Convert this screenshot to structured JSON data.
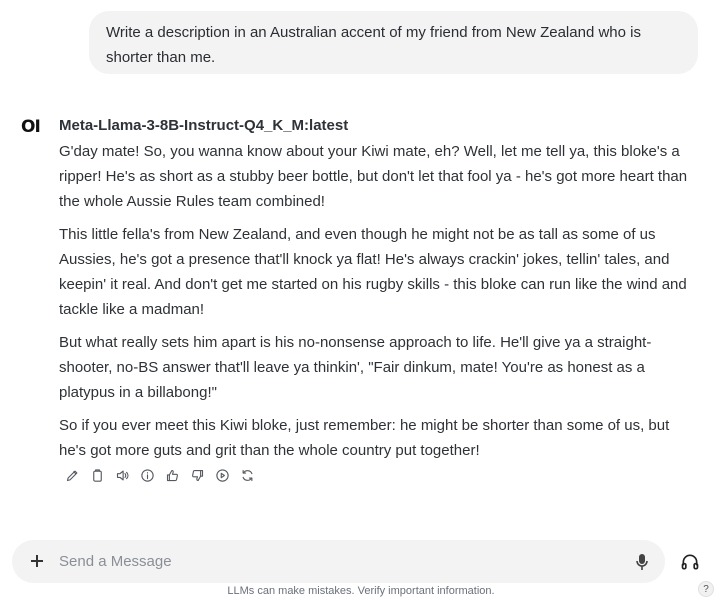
{
  "user_message": {
    "text": "Write a description in an Australian accent of my friend from New Zealand who is shorter than me."
  },
  "assistant": {
    "avatar": "OI",
    "model_name": "Meta-Llama-3-8B-Instruct-Q4_K_M:latest",
    "paragraphs": [
      "G'day mate! So, you wanna know about your Kiwi mate, eh? Well, let me tell ya, this bloke's a ripper! He's as short as a stubby beer bottle, but don't let that fool ya - he's got more heart than the whole Aussie Rules team combined!",
      "This little fella's from New Zealand, and even though he might not be as tall as some of us Aussies, he's got a presence that'll knock ya flat! He's always crackin' jokes, tellin' tales, and keepin' it real. And don't get me started on his rugby skills - this bloke can run like the wind and tackle like a madman!",
      "But what really sets him apart is his no-nonsense approach to life. He'll give ya a straight-shooter, no-BS answer that'll leave ya thinkin', \"Fair dinkum, mate! You're as honest as a platypus in a billabong!\"",
      "So if you ever meet this Kiwi bloke, just remember: he might be shorter than some of us, but he's got more guts and grit than the whole country put together!"
    ],
    "action_icons": [
      "edit-icon",
      "copy-icon",
      "speaker-icon",
      "info-icon",
      "thumbs-up-icon",
      "thumbs-down-icon",
      "play-icon",
      "regenerate-icon"
    ]
  },
  "composer": {
    "placeholder": "Send a Message",
    "icons": [
      "plus-icon",
      "microphone-icon",
      "headphones-icon"
    ]
  },
  "footer": {
    "disclaimer": "LLMs can make mistakes. Verify important information.",
    "help": "?"
  }
}
